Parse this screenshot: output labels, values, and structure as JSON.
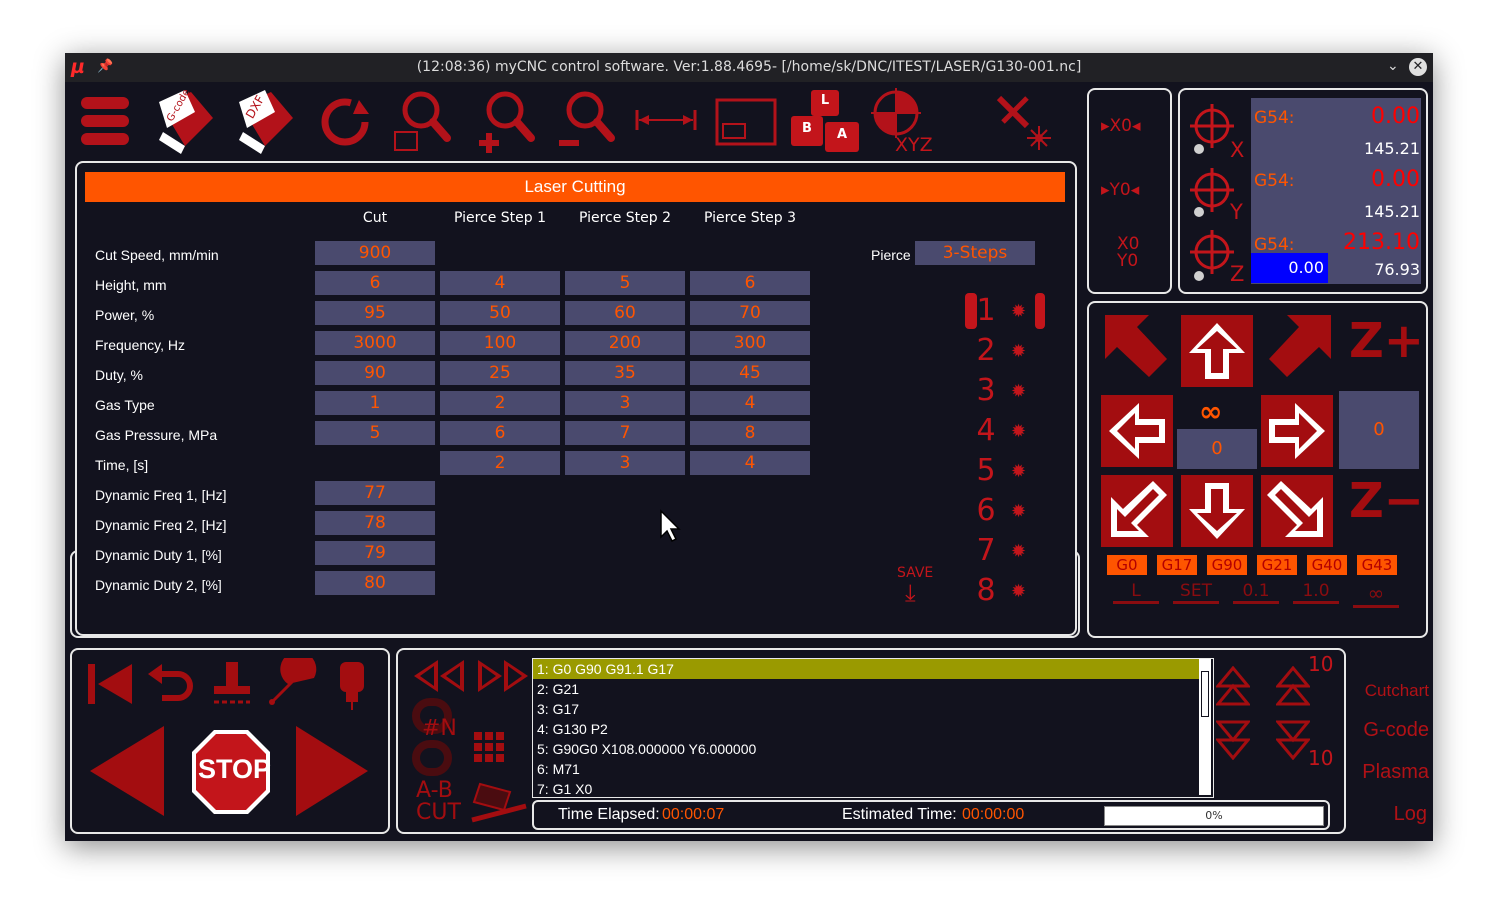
{
  "window": {
    "title": "(12:08:36) myCNC control software. Ver:1.88.4695- [/home/sk/DNC/ITEST/LASER/G130-001.nc]"
  },
  "colors": {
    "accent": "#ff5500",
    "brand_red": "#c3151b",
    "background": "#12121e",
    "cell_bg": "#4a4a6e",
    "highlight": "#9a9a00"
  },
  "toolbar": {
    "icons": [
      "menu-icon",
      "gcode-open-icon",
      "dxf-open-icon",
      "reload-icon",
      "zoom-window-icon",
      "zoom-in-icon",
      "zoom-out-icon",
      "measure-icon",
      "frame-icon",
      "keyboard-lba-icon",
      "origin-xyz-icon",
      "tools-laser-icon"
    ],
    "gcode_label": "G-code",
    "dxf_label": "DXF",
    "key_l": "L",
    "key_b": "B",
    "key_a": "A",
    "xyz_label": "XYZ"
  },
  "laser": {
    "title": "Laser Cutting",
    "columns": [
      "Cut",
      "Pierce Step 1",
      "Pierce Step 2",
      "Pierce Step 3"
    ],
    "rows": [
      {
        "label": "Cut Speed, mm/min",
        "cut": "900",
        "s1": "",
        "s2": "",
        "s3": ""
      },
      {
        "label": "Height, mm",
        "cut": "6",
        "s1": "4",
        "s2": "5",
        "s3": "6"
      },
      {
        "label": "Power, %",
        "cut": "95",
        "s1": "50",
        "s2": "60",
        "s3": "70"
      },
      {
        "label": "Frequency, Hz",
        "cut": "3000",
        "s1": "100",
        "s2": "200",
        "s3": "300"
      },
      {
        "label": "Duty, %",
        "cut": "90",
        "s1": "25",
        "s2": "35",
        "s3": "45"
      },
      {
        "label": "Gas Type",
        "cut": "1",
        "s1": "2",
        "s2": "3",
        "s3": "4"
      },
      {
        "label": "Gas Pressure, MPa",
        "cut": "5",
        "s1": "6",
        "s2": "7",
        "s3": "8"
      },
      {
        "label": "Time, [s]",
        "cut": "",
        "s1": "2",
        "s2": "3",
        "s3": "4"
      },
      {
        "label": "Dynamic Freq 1, [Hz]",
        "cut": "77",
        "s1": "",
        "s2": "",
        "s3": ""
      },
      {
        "label": "Dynamic Freq 2, [Hz]",
        "cut": "78",
        "s1": "",
        "s2": "",
        "s3": ""
      },
      {
        "label": "Dynamic Duty 1, [%]",
        "cut": "79",
        "s1": "",
        "s2": "",
        "s3": ""
      },
      {
        "label": "Dynamic Duty 2, [%]",
        "cut": "80",
        "s1": "",
        "s2": "",
        "s3": ""
      }
    ],
    "pierce_label": "Pierce",
    "pierce_value": "3-Steps",
    "steps": [
      "1",
      "2",
      "3",
      "4",
      "5",
      "6",
      "7",
      "8"
    ],
    "save_label": "SAVE"
  },
  "zero_buttons": {
    "x": "▸X0◂",
    "y": "▸Y0◂",
    "xy_top": "X0",
    "xy_bottom": "Y0"
  },
  "coords": {
    "x": {
      "wcs": "G54:",
      "work": "0.00",
      "machine": "145.21",
      "axis": "X"
    },
    "y": {
      "wcs": "G54:",
      "work": "0.00",
      "machine": "145.21",
      "axis": "Y"
    },
    "z": {
      "wcs": "G54:",
      "work": "213.10",
      "machine": "76.93",
      "axis": "Z",
      "input": "0.00"
    }
  },
  "jog": {
    "z_plus": "Z+",
    "z_minus": "Z−",
    "infinity": "∞",
    "step_value": "0",
    "z_value": "0",
    "modes": [
      "G0",
      "G17",
      "G90",
      "G21",
      "G40",
      "G43"
    ],
    "bottom": [
      "L",
      "SET",
      "0.1",
      "1.0",
      "∞"
    ]
  },
  "control": {
    "stop_label": "STOP",
    "ab_cut": "A-B\nCUT",
    "hash_n": "#N"
  },
  "gcode": {
    "lines": [
      "1: G0 G90 G91.1 G17",
      "2: G21",
      "3: G17",
      "4: G130 P2",
      "5: G90G0 X108.000000 Y6.000000",
      "6: M71",
      "7: G1 X0"
    ],
    "selected": 0,
    "time_elapsed_label": "Time Elapsed:",
    "time_elapsed": "00:00:07",
    "estimated_label": "Estimated Time:",
    "estimated": "00:00:00",
    "progress": 0,
    "progress_label": "0%"
  },
  "feed": {
    "up_value": "10",
    "down_value": "10"
  },
  "side_tabs": [
    "Cutchart",
    "G-code",
    "Plasma",
    "Log"
  ]
}
